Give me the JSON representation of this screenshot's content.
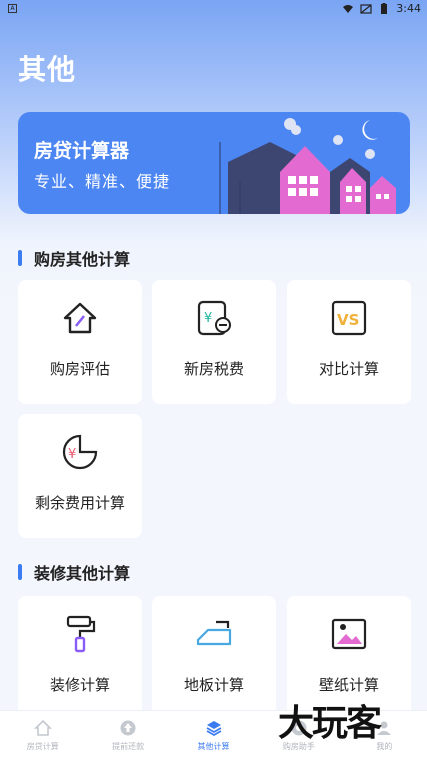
{
  "status_bar": {
    "time": "3:44",
    "left_glyph": "A"
  },
  "page": {
    "title": "其他"
  },
  "banner": {
    "title": "房贷计算器",
    "subtitle": "专业、精准、便捷"
  },
  "section1": {
    "title": "购房其他计算",
    "cards": [
      {
        "label": "购房评估",
        "icon": "house-pencil-icon"
      },
      {
        "label": "新房税费",
        "icon": "tax-document-icon"
      },
      {
        "label": "对比计算",
        "icon": "vs-icon"
      },
      {
        "label": "剩余费用计算",
        "icon": "yuan-pie-icon"
      }
    ]
  },
  "section2": {
    "title": "装修其他计算",
    "cards": [
      {
        "label": "装修计算",
        "icon": "paint-roller-icon"
      },
      {
        "label": "地板计算",
        "icon": "floor-icon"
      },
      {
        "label": "壁纸计算",
        "icon": "wallpaper-icon"
      }
    ]
  },
  "tabbar": {
    "tabs": [
      {
        "label": "房贷计算",
        "icon": "home-icon",
        "active": false
      },
      {
        "label": "提前还款",
        "icon": "upload-icon",
        "active": false
      },
      {
        "label": "其他计算",
        "icon": "layers-icon",
        "active": true
      },
      {
        "label": "购房助手",
        "icon": "helper-icon",
        "active": false
      },
      {
        "label": "我的",
        "icon": "user-icon",
        "active": false
      }
    ]
  },
  "watermark": {
    "text": "大玩客"
  },
  "colors": {
    "accent": "#3b7cf0",
    "banner": "#4c86f3",
    "icon_orange": "#f0b13a",
    "icon_purple": "#8a5cf6",
    "icon_pink": "#e8566b"
  }
}
